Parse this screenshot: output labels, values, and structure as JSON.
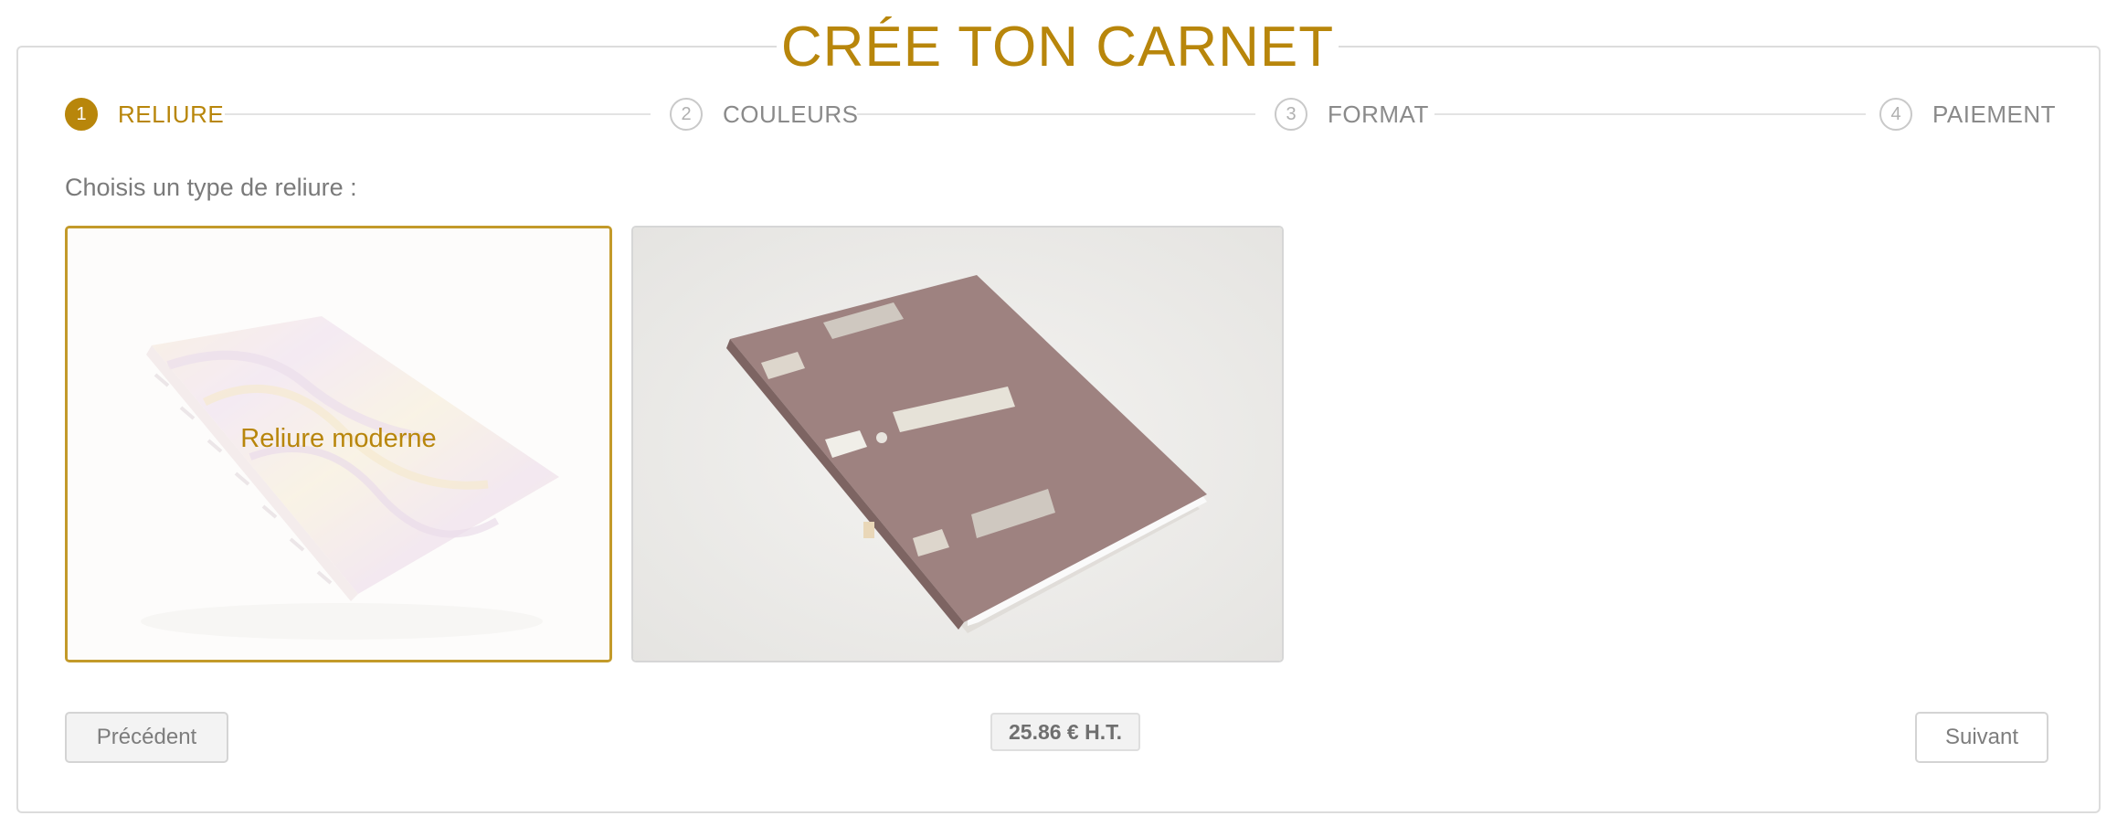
{
  "page": {
    "title": "CRÉE TON CARNET",
    "accent_color": "#b8860b"
  },
  "steps": [
    {
      "number": "1",
      "label": "RELIURE",
      "active": true
    },
    {
      "number": "2",
      "label": "COULEURS",
      "active": false
    },
    {
      "number": "3",
      "label": "FORMAT",
      "active": false
    },
    {
      "number": "4",
      "label": "PAIEMENT",
      "active": false
    }
  ],
  "binding": {
    "prompt": "Choisis un type de reliure :",
    "options": [
      {
        "label": "Reliure moderne",
        "selected": true,
        "image": "marbled-coptic-notebook"
      },
      {
        "label": "",
        "selected": false,
        "image": "brown-long-stitch-notebook"
      }
    ]
  },
  "footer": {
    "prev_label": "Précédent",
    "price": "25.86 € H.T.",
    "next_label": "Suivant"
  }
}
